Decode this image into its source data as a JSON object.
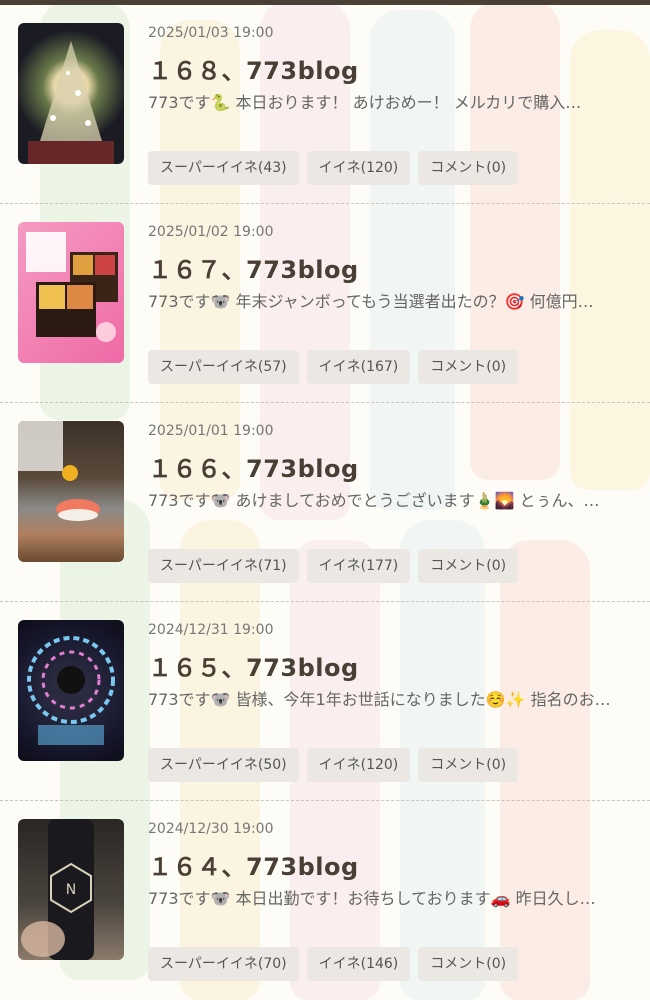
{
  "posts": [
    {
      "date": "2025/01/03 19:00",
      "title": "１６８、773blog",
      "excerpt": "773です🐍 本日おります！ あけおめー！ メルカリで購入…",
      "super_like": "スーパーイイネ(43)",
      "like": "イイネ(120)",
      "comment": "コメント(0)",
      "thumb_icon": "christmas-tree-photo"
    },
    {
      "date": "2025/01/02 19:00",
      "title": "１６７、773blog",
      "excerpt": "773です🐨 年末ジャンボってもう当選者出たの？🎯 何億円…",
      "super_like": "スーパーイイネ(57)",
      "like": "イイネ(167)",
      "comment": "コメント(0)",
      "thumb_icon": "osechi-photo"
    },
    {
      "date": "2025/01/01 19:00",
      "title": "１６６、773blog",
      "excerpt": "773です🐨 あけましておめでとうございます🎍🌄 とぅん、…",
      "super_like": "スーパーイイネ(71)",
      "like": "イイネ(177)",
      "comment": "コメント(0)",
      "thumb_icon": "sushi-photo"
    },
    {
      "date": "2024/12/31 19:00",
      "title": "１６５、773blog",
      "excerpt": "773です🐨 皆様、今年1年お世話になりました☺️✨ 指名のお…",
      "super_like": "スーパーイイネ(50)",
      "like": "イイネ(120)",
      "comment": "コメント(0)",
      "thumb_icon": "glass-art-photo"
    },
    {
      "date": "2024/12/30 19:00",
      "title": "１６４、773blog",
      "excerpt": "773です🐨 本日出勤です！お待ちしております🚗 昨日久し…",
      "super_like": "スーパーイイネ(70)",
      "like": "イイネ(146)",
      "comment": "コメント(0)",
      "thumb_icon": "bottle-photo"
    }
  ]
}
